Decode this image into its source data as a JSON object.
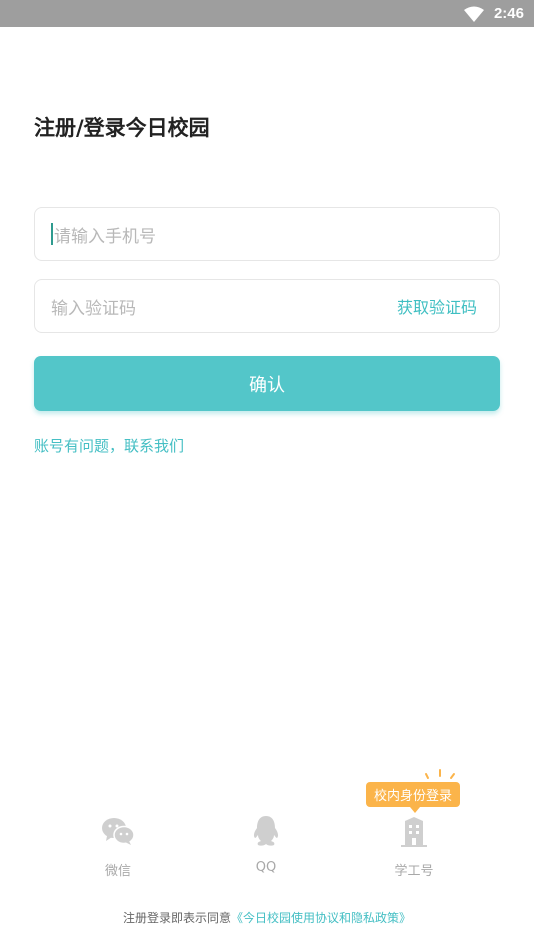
{
  "status_bar": {
    "time": "2:46",
    "icons": [
      "wifi-icon",
      "battery-icon"
    ]
  },
  "title": "注册/登录今日校园",
  "phone_input": {
    "placeholder": "请输入手机号"
  },
  "code_input": {
    "placeholder": "输入验证码",
    "get_code_label": "获取验证码"
  },
  "confirm_button": "确认",
  "help_link": "账号有问题，联系我们",
  "badge": "校内身份登录",
  "login_options": [
    {
      "label": "微信",
      "icon": "wechat-icon"
    },
    {
      "label": "QQ",
      "icon": "qq-icon"
    },
    {
      "label": "学工号",
      "icon": "building-icon"
    }
  ],
  "agreement": {
    "prefix": "注册登录即表示同意",
    "policy": "《今日校园使用协议和隐私政策》"
  },
  "colors": {
    "accent": "#53c6c9",
    "link": "#45bfc4",
    "badge": "#fbb44a",
    "status_bar": "#9e9e9e"
  }
}
